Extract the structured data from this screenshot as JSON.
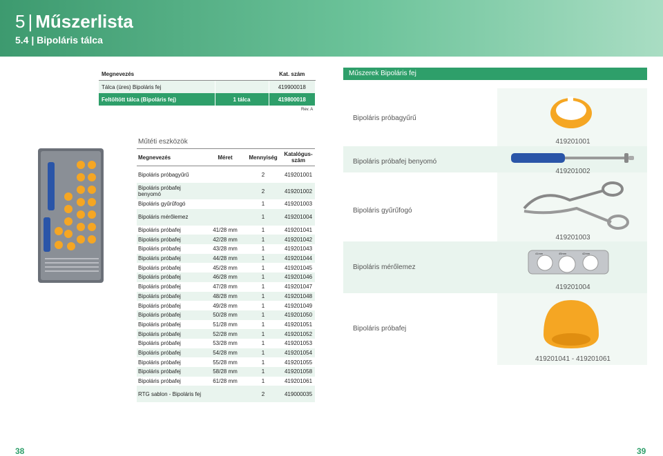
{
  "header": {
    "number": "5",
    "title": "Műszerlista",
    "subtitle": "5.4 | Bipoláris tálca"
  },
  "tray_table": {
    "headers": [
      "Megnevezés",
      "",
      "Kat. szám"
    ],
    "rows": [
      [
        "Tálca (üres) Bipoláris fej",
        "",
        "419900018"
      ],
      [
        "Feltöltött tálca (Bipoláris fej)",
        "1 tálca",
        "419800018"
      ]
    ],
    "rev": "Rev. A"
  },
  "tools": {
    "title": "Műtéti eszközök",
    "headers": [
      "Megnevezés",
      "Méret",
      "Mennyiség",
      "Katalógus-szám"
    ],
    "rows": [
      [
        "Bipoláris próbagyűrű",
        "",
        "2",
        "419201001"
      ],
      [
        "Bipoláris próbafej benyomó",
        "",
        "2",
        "419201002"
      ],
      [
        "Bipoláris gyűrűfogó",
        "",
        "1",
        "419201003"
      ],
      [
        "Bipoláris mérőlemez",
        "",
        "1",
        "419201004"
      ],
      [
        "Bipoláris próbafej",
        "41/28 mm",
        "1",
        "419201041"
      ],
      [
        "Bipoláris próbafej",
        "42/28 mm",
        "1",
        "419201042"
      ],
      [
        "Bipoláris próbafej",
        "43/28 mm",
        "1",
        "419201043"
      ],
      [
        "Bipoláris próbafej",
        "44/28 mm",
        "1",
        "419201044"
      ],
      [
        "Bipoláris próbafej",
        "45/28 mm",
        "1",
        "419201045"
      ],
      [
        "Bipoláris próbafej",
        "46/28 mm",
        "1",
        "419201046"
      ],
      [
        "Bipoláris próbafej",
        "47/28 mm",
        "1",
        "419201047"
      ],
      [
        "Bipoláris próbafej",
        "48/28 mm",
        "1",
        "419201048"
      ],
      [
        "Bipoláris próbafej",
        "49/28 mm",
        "1",
        "419201049"
      ],
      [
        "Bipoláris próbafej",
        "50/28 mm",
        "1",
        "419201050"
      ],
      [
        "Bipoláris próbafej",
        "51/28 mm",
        "1",
        "419201051"
      ],
      [
        "Bipoláris próbafej",
        "52/28 mm",
        "1",
        "419201052"
      ],
      [
        "Bipoláris próbafej",
        "53/28 mm",
        "1",
        "419201053"
      ],
      [
        "Bipoláris próbafej",
        "54/28 mm",
        "1",
        "419201054"
      ],
      [
        "Bipoláris próbafej",
        "55/28 mm",
        "1",
        "419201055"
      ],
      [
        "Bipoláris próbafej",
        "58/28 mm",
        "1",
        "419201058"
      ],
      [
        "Bipoláris próbafej",
        "61/28 mm",
        "1",
        "419201061"
      ],
      [
        "RTG sablon - Bipoláris fej",
        "",
        "2",
        "419000035"
      ]
    ]
  },
  "right": {
    "title": "Műszerek Bipoláris fej",
    "items": [
      {
        "label": "Bipoláris próbagyűrű",
        "number": "419201001"
      },
      {
        "label": "Bipoláris próbafej benyomó",
        "number": "419201002"
      },
      {
        "label": "Bipoláris gyűrűfogó",
        "number": "419201003"
      },
      {
        "label": "Bipoláris mérőlemez",
        "number": "419201004"
      },
      {
        "label": "Bipoláris próbafej",
        "number": "419201041 - 419201061"
      }
    ],
    "plate_labels": [
      "41mm",
      "45mm",
      "42mm"
    ]
  },
  "pages": {
    "left": "38",
    "right": "39"
  },
  "colors": {
    "green": "#2e9f6a",
    "light_green": "#e9f4ee",
    "orange": "#f5a623"
  }
}
